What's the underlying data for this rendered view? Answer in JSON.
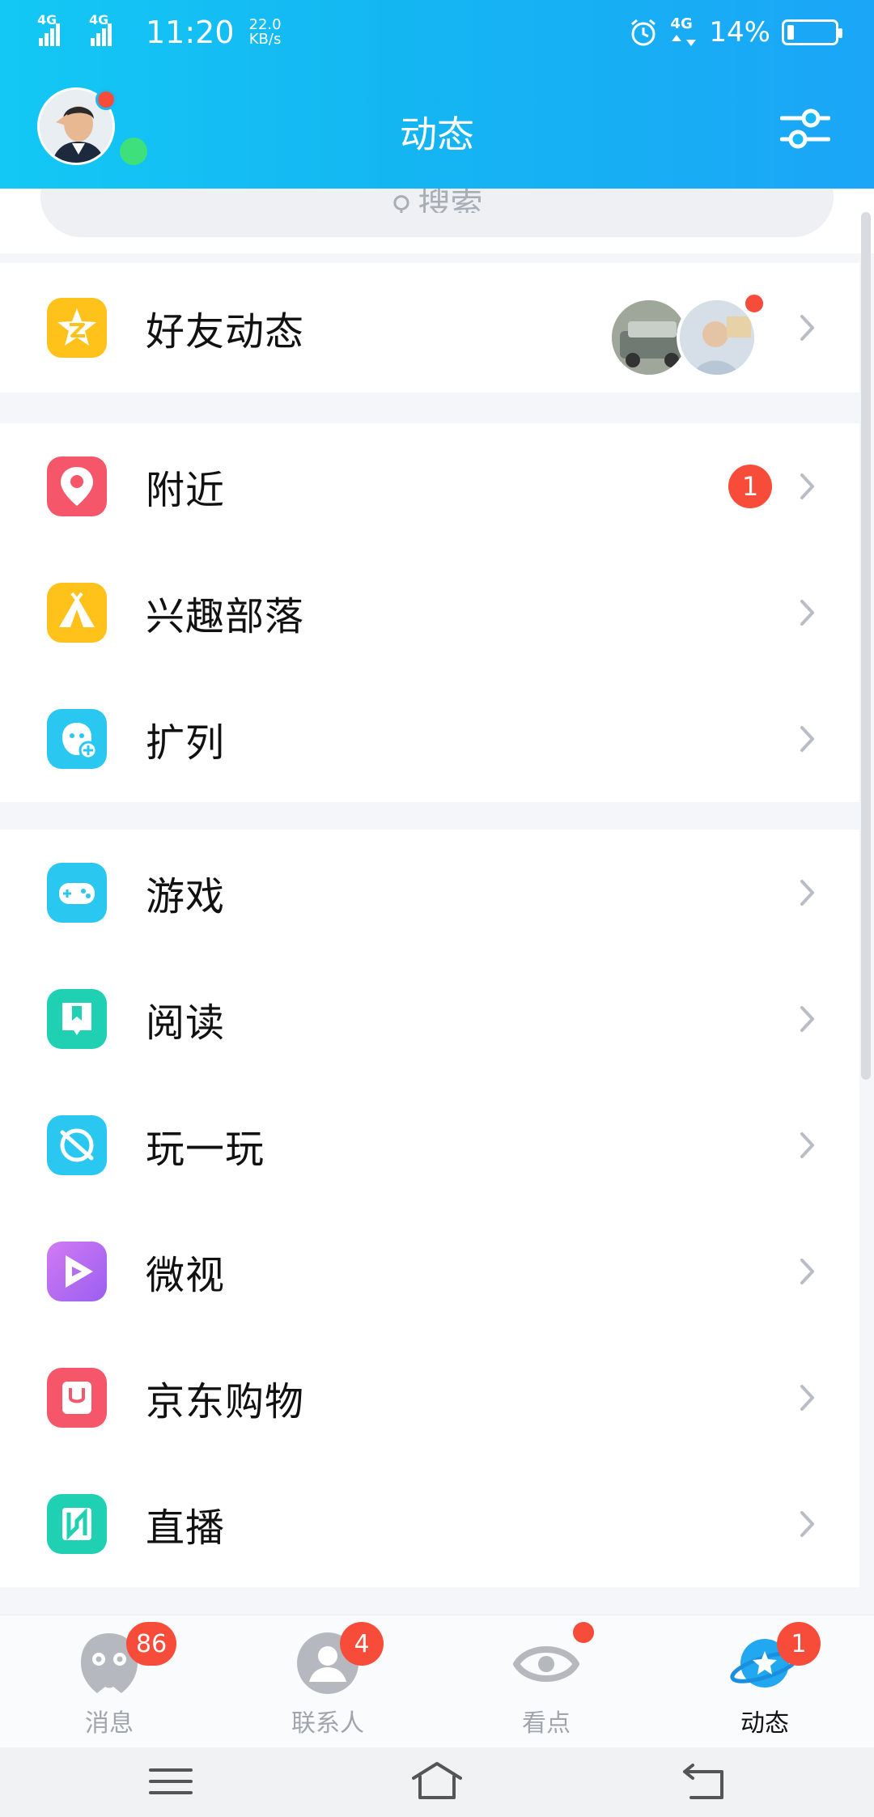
{
  "status_bar": {
    "signal1": "4G",
    "signal2": "4G",
    "time": "11:20",
    "speed_value": "22.0",
    "speed_unit": "KB/s",
    "network": "4G",
    "battery_percent": "14%"
  },
  "header": {
    "title": "动态"
  },
  "search": {
    "placeholder": "搜索"
  },
  "groups": [
    [
      {
        "label": "好友动态",
        "icon": "qzone-star-icon",
        "color": "#ffc21b"
      }
    ],
    [
      {
        "label": "附近",
        "icon": "location-pin-icon",
        "color": "#f5566a",
        "badge": "1"
      },
      {
        "label": "兴趣部落",
        "icon": "tent-icon",
        "color": "#ffc21b"
      },
      {
        "label": "扩列",
        "icon": "add-friend-face-icon",
        "color": "#2ac8f0"
      }
    ],
    [
      {
        "label": "游戏",
        "icon": "gamepad-icon",
        "color": "#2ac8f0"
      },
      {
        "label": "阅读",
        "icon": "book-icon",
        "color": "#1fd0b3"
      },
      {
        "label": "玩一玩",
        "icon": "planet-play-icon",
        "color": "#2ac8f0"
      },
      {
        "label": "微视",
        "icon": "play-triangle-icon",
        "color": "#b46ef0"
      },
      {
        "label": "京东购物",
        "icon": "shopping-bag-icon",
        "color": "#f5566a"
      },
      {
        "label": "直播",
        "icon": "live-icon",
        "color": "#1fd0b3"
      }
    ]
  ],
  "tabs": [
    {
      "label": "消息",
      "badge": "86",
      "icon": "message-penguin-icon",
      "active": false
    },
    {
      "label": "联系人",
      "badge": "4",
      "icon": "contact-person-icon",
      "active": false
    },
    {
      "label": "看点",
      "icon": "eye-icon",
      "active": false,
      "dot": true
    },
    {
      "label": "动态",
      "badge": "1",
      "icon": "planet-star-icon",
      "active": true
    }
  ]
}
